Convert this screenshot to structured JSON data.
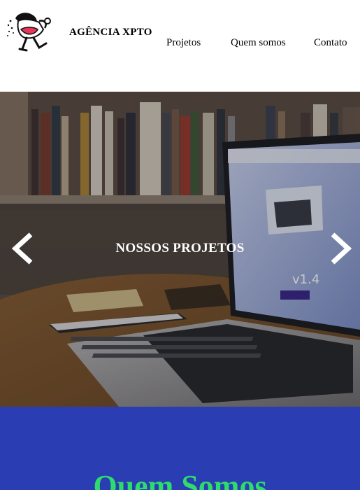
{
  "header": {
    "brand": "AGÊNCIA XPTO",
    "logo_icon": "mascot-logo-icon",
    "nav": [
      {
        "label": "Projetos"
      },
      {
        "label": "Quem somos"
      },
      {
        "label": "Contato"
      }
    ]
  },
  "hero": {
    "title": "NOSSOS PROJETOS",
    "prev_icon": "chevron-left-icon",
    "next_icon": "chevron-right-icon"
  },
  "about": {
    "title": "Quem Somos",
    "background_color": "#2a3db3",
    "title_color": "#2ddc6a"
  }
}
